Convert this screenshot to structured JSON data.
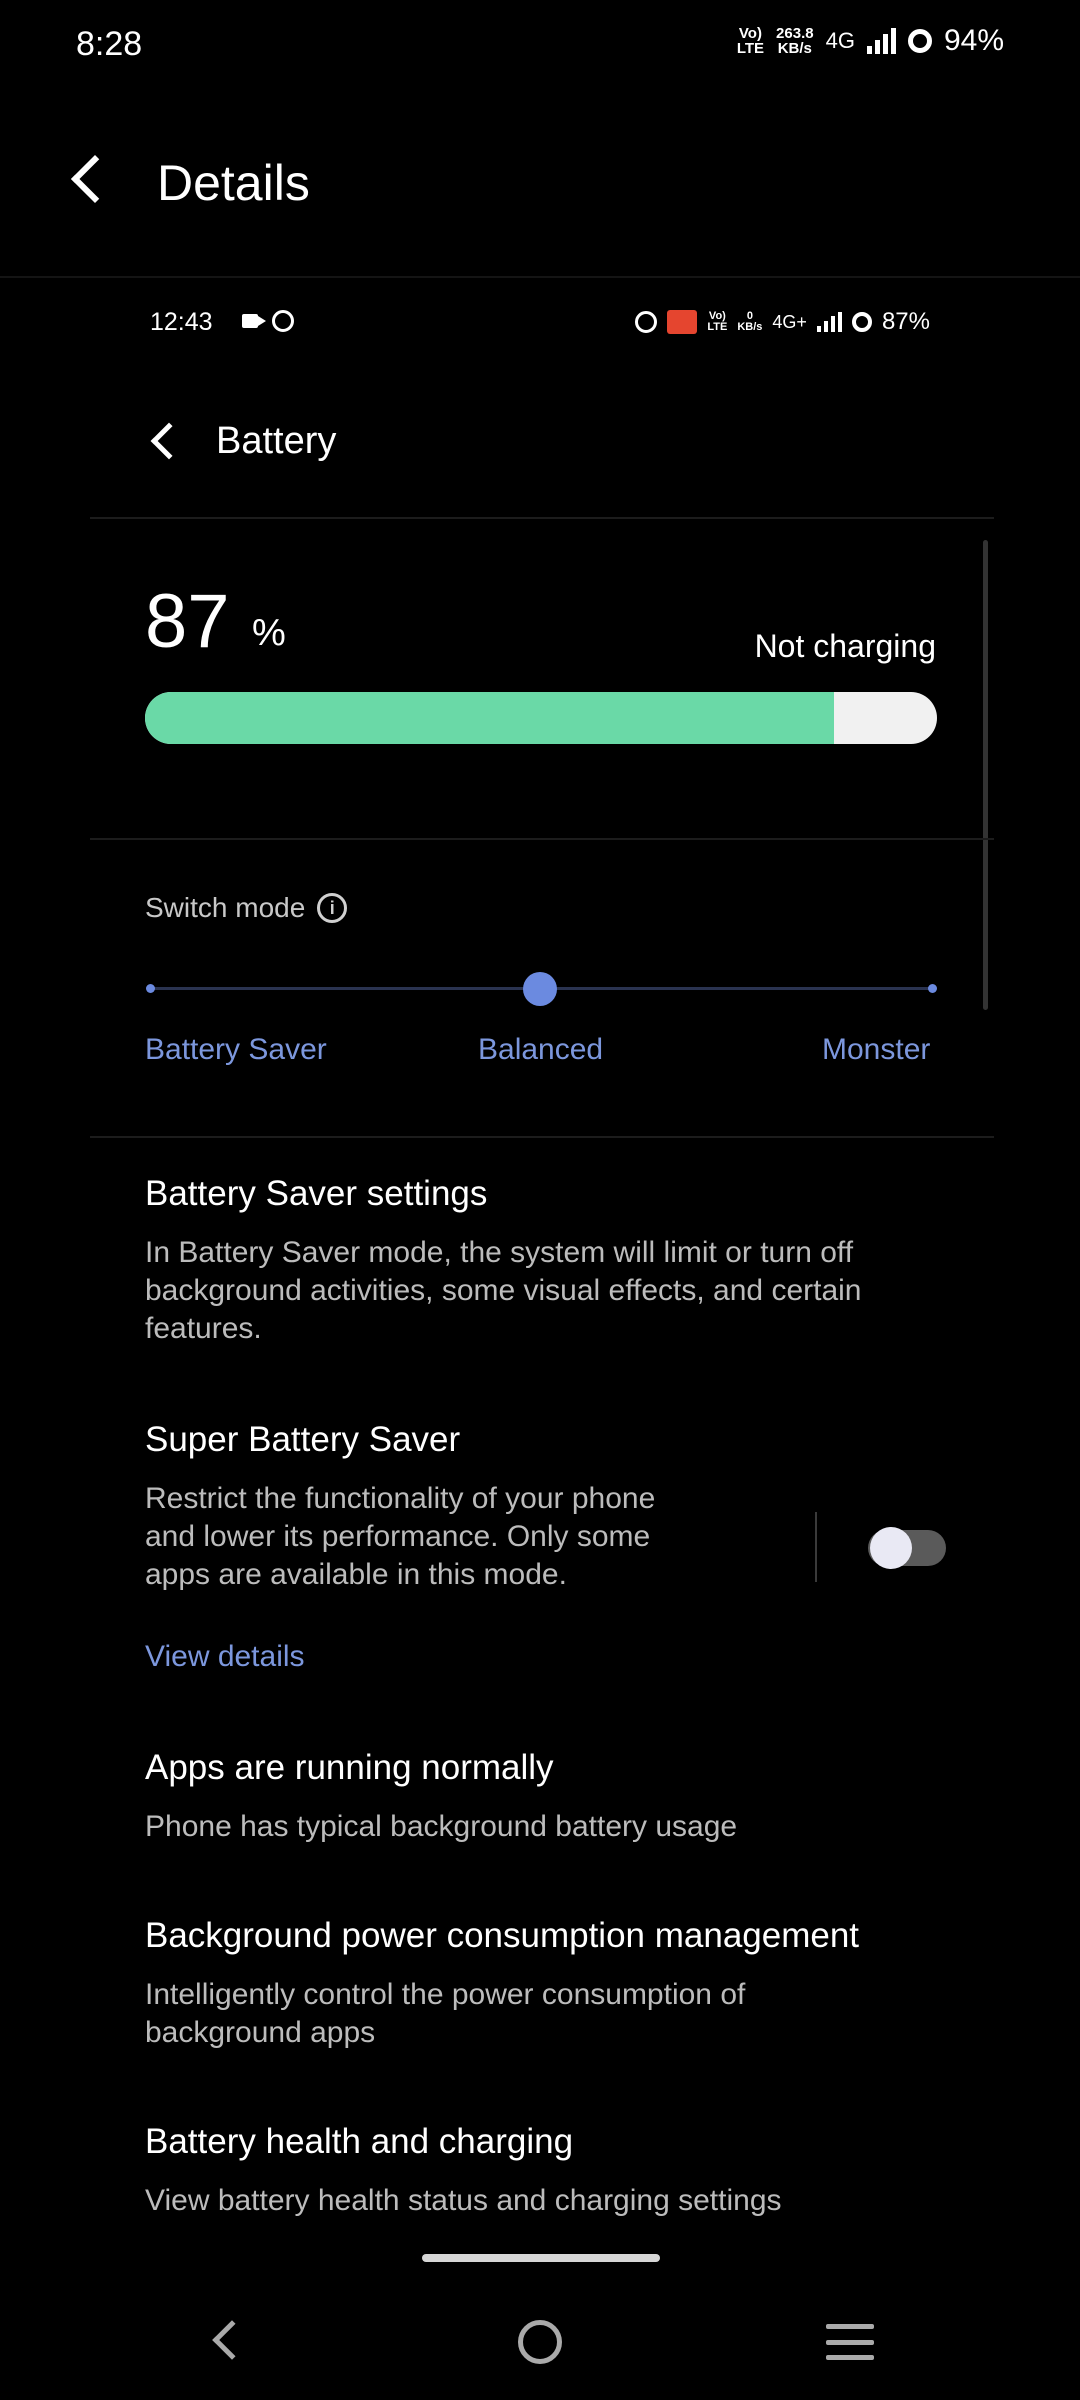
{
  "outer_status": {
    "time": "8:28",
    "volte_top": "Vo)",
    "volte_bottom": "LTE",
    "speed_value": "263.8",
    "speed_unit": "KB/s",
    "network": "4G",
    "battery": "94%"
  },
  "header": {
    "title": "Details"
  },
  "screenshot": {
    "status": {
      "time": "12:43",
      "volte_top": "Vo)",
      "volte_bottom": "LTE",
      "speed_value": "0",
      "speed_unit": "KB/s",
      "network": "4G+",
      "battery": "87%"
    },
    "title": "Battery",
    "battery": {
      "level_number": "87",
      "level_fraction": 0.87,
      "percent_sign": "%",
      "charging_status": "Not charging",
      "fill_color": "#6ad9a7"
    },
    "switch_mode": {
      "label": "Switch mode",
      "options": [
        "Battery Saver",
        "Balanced",
        "Monster"
      ],
      "selected": "Balanced",
      "accent": "#7c97dd"
    },
    "items": [
      {
        "title": "Battery Saver settings",
        "description": "In Battery Saver mode, the system will limit or turn off background activities, some visual effects, and certain features."
      },
      {
        "title": "Super Battery Saver",
        "description": "Restrict the functionality of your phone and lower its performance. Only some apps are available in this mode.",
        "link": "View details",
        "toggle_on": false
      },
      {
        "title": "Apps are running normally",
        "description": "Phone has typical background battery usage"
      },
      {
        "title": "Background power consumption management",
        "description": "Intelligently control the power consumption of background apps"
      },
      {
        "title": "Battery health and charging",
        "description": "View battery health status and charging settings"
      }
    ]
  }
}
